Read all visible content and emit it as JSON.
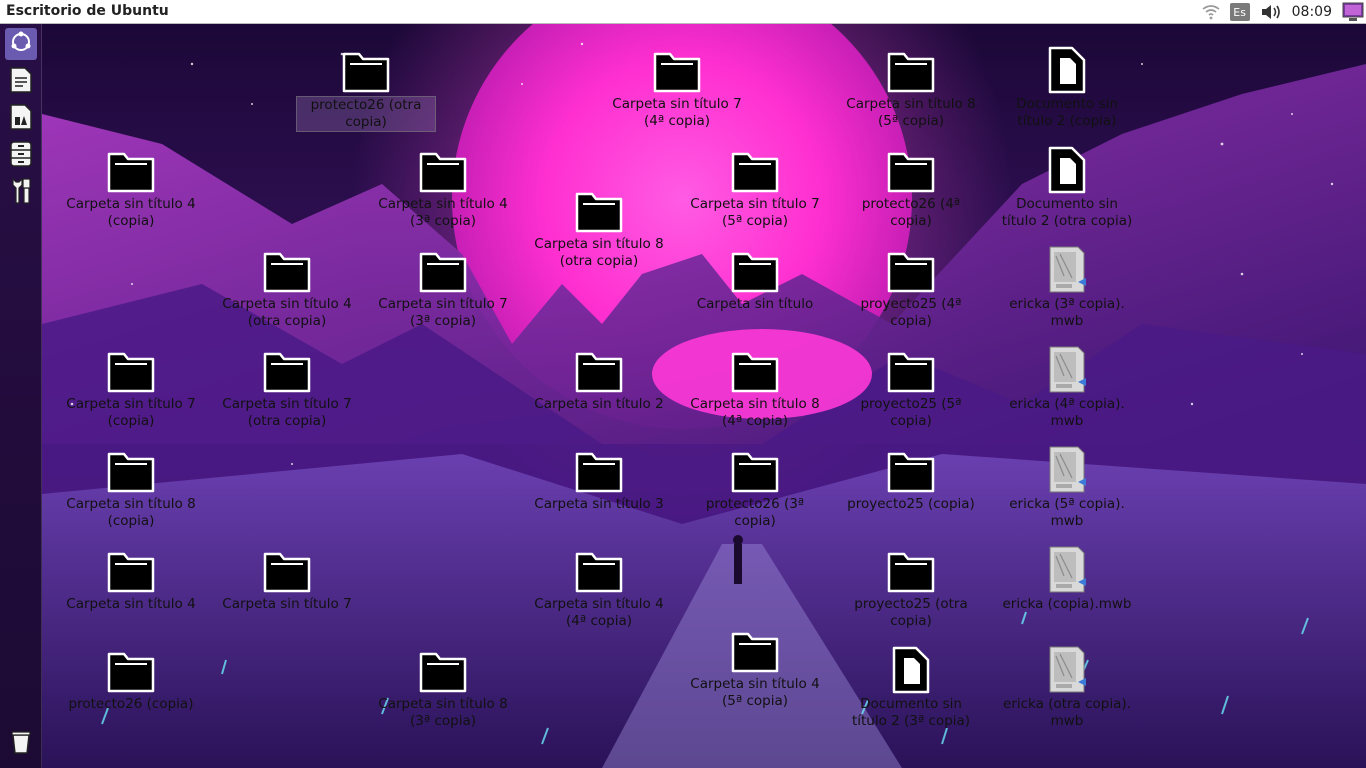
{
  "top_panel": {
    "title": "Escritorio de Ubuntu",
    "keyboard_layout": "Es",
    "clock": "08:09",
    "icons": [
      "wifi-icon",
      "volume-icon",
      "session-icon"
    ]
  },
  "launcher": {
    "items": [
      {
        "name": "dash-home",
        "icon": "ubuntu-logo-icon"
      },
      {
        "name": "libreoffice-writer",
        "icon": "writer-icon"
      },
      {
        "name": "libreoffice-draw",
        "icon": "draw-icon"
      },
      {
        "name": "file-cabinet",
        "icon": "cabinet-icon"
      },
      {
        "name": "system-settings",
        "icon": "tools-icon"
      },
      {
        "name": "trash",
        "icon": "trash-icon"
      }
    ]
  },
  "colors": {
    "panel_bg": "#ffffff",
    "launcher_bg": "#281046",
    "sun": "#ff33d6",
    "sky": "#3a1560"
  },
  "desktop": {
    "icons": [
      {
        "label": "protecto26 (otra copia)",
        "type": "folder"
      },
      {
        "label": "Carpeta sin título 7 (4ª copia)",
        "type": "folder"
      },
      {
        "label": "Carpeta sin título 8 (5ª copia)",
        "type": "folder"
      },
      {
        "label": "Documento sin título 2 (copia)",
        "type": "document"
      },
      {
        "label": "Carpeta sin título 4 (copia)",
        "type": "folder"
      },
      {
        "label": "Carpeta sin título 4 (3ª copia)",
        "type": "folder"
      },
      {
        "label": "Carpeta sin título 8 (otra copia)",
        "type": "folder"
      },
      {
        "label": "Carpeta sin título 7 (5ª copia)",
        "type": "folder"
      },
      {
        "label": "protecto26 (4ª copia)",
        "type": "folder"
      },
      {
        "label": "Documento sin título 2 (otra copia)",
        "type": "document"
      },
      {
        "label": "Carpeta sin título 4 (otra copia)",
        "type": "folder"
      },
      {
        "label": "Carpeta sin título 7 (3ª copia)",
        "type": "folder"
      },
      {
        "label": "Carpeta sin título",
        "type": "folder"
      },
      {
        "label": "proyecto25 (4ª copia)",
        "type": "folder"
      },
      {
        "label": "ericka (3ª copia). mwb",
        "type": "mwb"
      },
      {
        "label": "Carpeta sin título 7 (copia)",
        "type": "folder"
      },
      {
        "label": "Carpeta sin título 7 (otra copia)",
        "type": "folder"
      },
      {
        "label": "Carpeta sin título 2",
        "type": "folder"
      },
      {
        "label": "Carpeta sin título 8 (4ª copia)",
        "type": "folder"
      },
      {
        "label": "proyecto25 (5ª copia)",
        "type": "folder"
      },
      {
        "label": "ericka (4ª copia). mwb",
        "type": "mwb"
      },
      {
        "label": "Carpeta sin título 8 (copia)",
        "type": "folder"
      },
      {
        "label": "Carpeta sin título 3",
        "type": "folder"
      },
      {
        "label": "protecto26 (3ª copia)",
        "type": "folder"
      },
      {
        "label": "proyecto25 (copia)",
        "type": "folder"
      },
      {
        "label": "ericka (5ª copia). mwb",
        "type": "mwb"
      },
      {
        "label": "Carpeta sin título 4",
        "type": "folder"
      },
      {
        "label": "Carpeta sin título 7",
        "type": "folder"
      },
      {
        "label": "Carpeta sin título 4 (4ª copia)",
        "type": "folder"
      },
      {
        "label": "proyecto25 (otra copia)",
        "type": "folder"
      },
      {
        "label": "ericka (copia).mwb",
        "type": "mwb"
      },
      {
        "label": "protecto26 (copia)",
        "type": "folder"
      },
      {
        "label": "Carpeta sin título 8 (3ª copia)",
        "type": "folder"
      },
      {
        "label": "Carpeta sin título 4 (5ª copia)",
        "type": "folder"
      },
      {
        "label": "Documento sin título 2 (3ª copia)",
        "type": "document"
      },
      {
        "label": "ericka (otra copia). mwb",
        "type": "mwb"
      }
    ]
  }
}
